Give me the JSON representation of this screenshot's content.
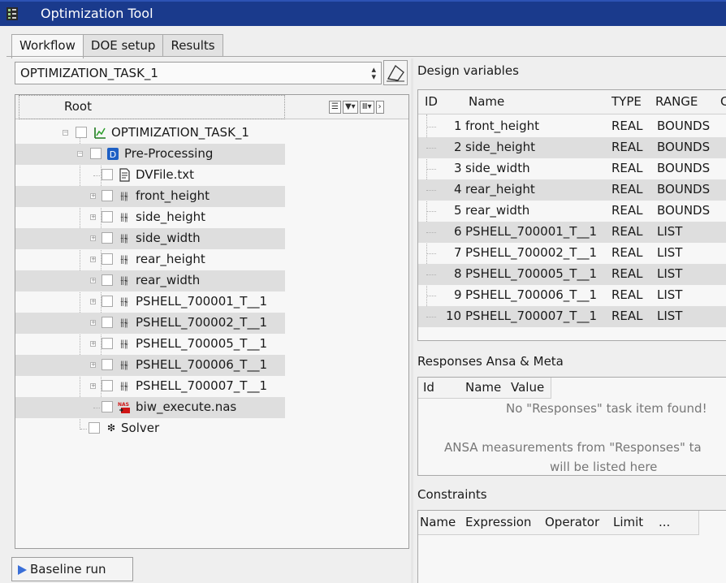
{
  "window": {
    "title": "Optimization Tool"
  },
  "tabs": [
    "Workflow",
    "DOE setup",
    "Results"
  ],
  "task_selector": {
    "value": "OPTIMIZATION_TASK_1"
  },
  "tree": {
    "column_header": "Root",
    "root": "OPTIMIZATION_TASK_1",
    "preprocessing": "Pre-Processing",
    "dvfile": "DVFile.txt",
    "variables": [
      "front_height",
      "side_height",
      "side_width",
      "rear_height",
      "rear_width",
      "PSHELL_700001_T__1",
      "PSHELL_700002_T__1",
      "PSHELL_700005_T__1",
      "PSHELL_700006_T__1",
      "PSHELL_700007_T__1"
    ],
    "nas_file": "biw_execute.nas",
    "solver": "Solver",
    "nas_icon_text": "NAS"
  },
  "baseline_button": "Baseline run",
  "design_variables": {
    "title": "Design variables",
    "columns": [
      "ID",
      "Name",
      "TYPE",
      "RANGE",
      "C"
    ],
    "rows": [
      {
        "id": "1",
        "name": "front_height",
        "type": "REAL",
        "range": "BOUNDS"
      },
      {
        "id": "2",
        "name": "side_height",
        "type": "REAL",
        "range": "BOUNDS"
      },
      {
        "id": "3",
        "name": "side_width",
        "type": "REAL",
        "range": "BOUNDS"
      },
      {
        "id": "4",
        "name": "rear_height",
        "type": "REAL",
        "range": "BOUNDS"
      },
      {
        "id": "5",
        "name": "rear_width",
        "type": "REAL",
        "range": "BOUNDS"
      },
      {
        "id": "6",
        "name": "PSHELL_700001_T__1",
        "type": "REAL",
        "range": "LIST"
      },
      {
        "id": "7",
        "name": "PSHELL_700002_T__1",
        "type": "REAL",
        "range": "LIST"
      },
      {
        "id": "8",
        "name": "PSHELL_700005_T__1",
        "type": "REAL",
        "range": "LIST"
      },
      {
        "id": "9",
        "name": "PSHELL_700006_T__1",
        "type": "REAL",
        "range": "LIST"
      },
      {
        "id": "10",
        "name": "PSHELL_700007_T__1",
        "type": "REAL",
        "range": "LIST"
      }
    ]
  },
  "responses": {
    "title": "Responses Ansa & Meta",
    "columns": [
      "Id",
      "Name",
      "Value"
    ],
    "empty_message": "No \"Responses\" task item found!",
    "info_line1": "ANSA measurements from \"Responses\" ta",
    "info_line2": "will be listed here"
  },
  "constraints": {
    "title": "Constraints",
    "columns": [
      "Name",
      "Expression",
      "Operator",
      "Limit",
      "..."
    ]
  },
  "icons": {
    "app": "app-icon",
    "eraser": "eraser-icon",
    "optimization": "optimization-task-icon",
    "preprocessing": "preprocessing-icon",
    "text_file": "text-file-icon",
    "variable": "sliders-icon",
    "nas": "nas-file-icon",
    "solver": "solver-icon",
    "expand_all": "expand-all-icon",
    "filter": "filter-icon",
    "columns": "columns-icon"
  }
}
